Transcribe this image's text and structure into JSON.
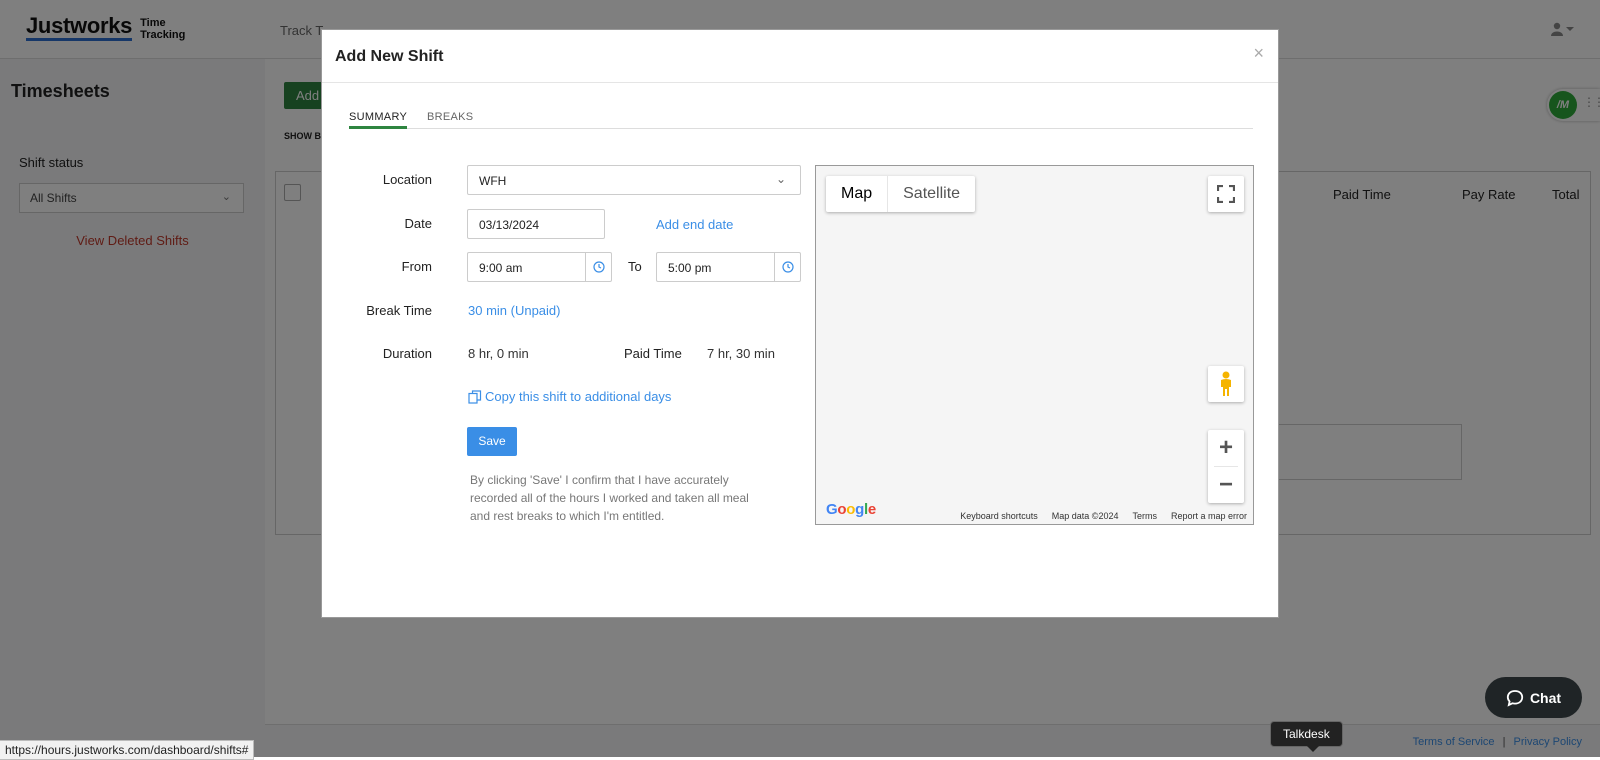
{
  "app": {
    "logo_main": "Justworks",
    "logo_sub_line1": "Time",
    "logo_sub_line2": "Tracking",
    "nav_items": [
      "Track T"
    ],
    "sidebar": {
      "title": "Timesheets",
      "shift_status_label": "Shift status",
      "shift_status_value": "All Shifts",
      "deleted_link": "View Deleted Shifts"
    },
    "main": {
      "add_button": "Add",
      "show_label": "SHOW B",
      "columns": [
        "Paid Time",
        "Pay Rate",
        "Total"
      ]
    },
    "footer": {
      "terms": "Terms of Service",
      "separator": "|",
      "privacy": "Privacy Policy"
    },
    "extension_badge": "/M"
  },
  "modal": {
    "title": "Add New Shift",
    "close_glyph": "×",
    "tabs": [
      {
        "label": "SUMMARY",
        "active": true
      },
      {
        "label": "BREAKS",
        "active": false
      }
    ],
    "form": {
      "location_label": "Location",
      "location_value": "WFH",
      "date_label": "Date",
      "date_value": "03/13/2024",
      "add_end_date": "Add end date",
      "from_label": "From",
      "from_value": "9:00 am",
      "to_label": "To",
      "to_value": "5:00 pm",
      "break_label": "Break Time",
      "break_value": "30 min (Unpaid)",
      "duration_label": "Duration",
      "duration_value": "8 hr, 0 min",
      "paid_label": "Paid Time",
      "paid_value": "7 hr, 30 min",
      "copy_link": "Copy this shift to additional days",
      "save_label": "Save",
      "disclaimer": "By clicking 'Save' I confirm that I have accurately recorded all of the hours I worked and taken all meal and rest breaks to which I'm entitled."
    },
    "map": {
      "map_tab": "Map",
      "satellite_tab": "Satellite",
      "zoom_in": "+",
      "zoom_out": "−",
      "google_letters": [
        "G",
        "o",
        "o",
        "g",
        "l",
        "e"
      ],
      "google_colors": [
        "#4285F4",
        "#EA4335",
        "#FBBC05",
        "#4285F4",
        "#34A853",
        "#EA4335"
      ],
      "footer": [
        "Keyboard shortcuts",
        "Map data ©2024",
        "Terms",
        "Report a map error"
      ]
    }
  },
  "widgets": {
    "chat_label": "Chat",
    "talkdesk_tooltip": "Talkdesk",
    "status_url": "https://hours.justworks.com/dashboard/shifts#"
  },
  "colors": {
    "accent_green": "#2e8540",
    "link_blue": "#3a8ee6",
    "danger_red": "#c0392b"
  }
}
